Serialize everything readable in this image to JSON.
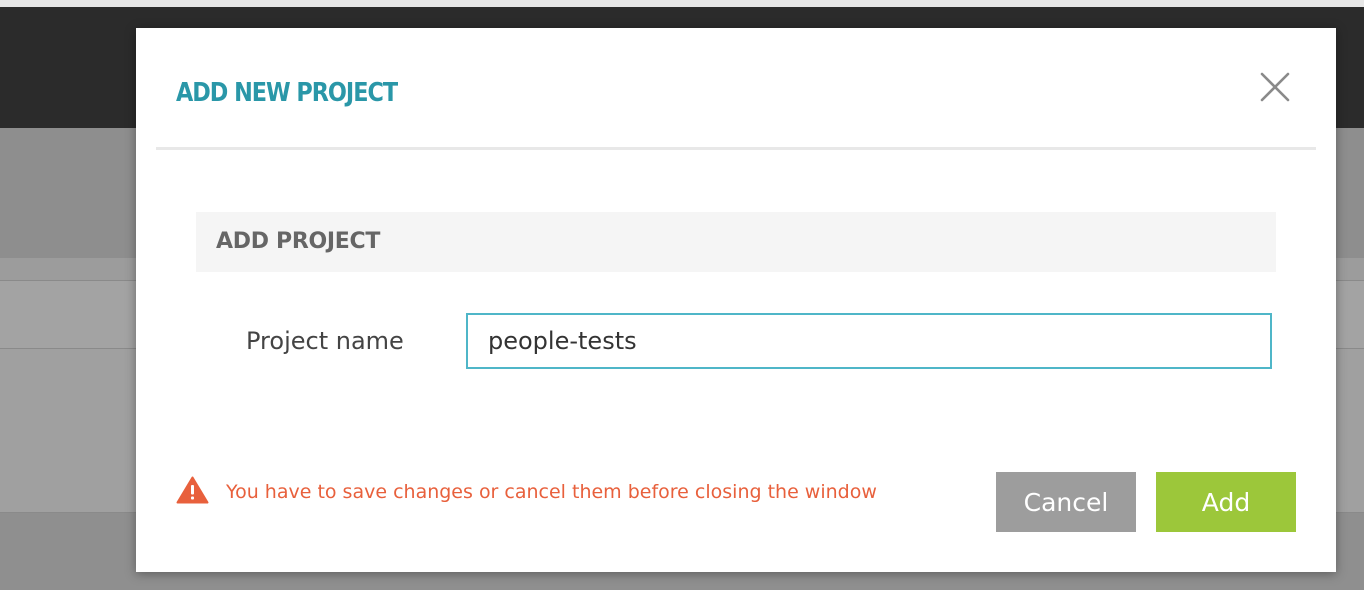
{
  "modal": {
    "title": "ADD NEW PROJECT",
    "close_icon": "close-icon"
  },
  "section": {
    "title": "ADD PROJECT"
  },
  "form": {
    "project_name_label": "Project name",
    "project_name_value": "people-tests"
  },
  "warning": {
    "icon": "warning-icon",
    "text": "You have to save changes or cancel them before closing the window",
    "color": "#e8603c"
  },
  "buttons": {
    "cancel_label": "Cancel",
    "add_label": "Add"
  },
  "colors": {
    "accent": "#2a97a8",
    "add_button": "#9cc73a",
    "cancel_button": "#9d9d9d",
    "input_border": "#4fb6c8"
  }
}
